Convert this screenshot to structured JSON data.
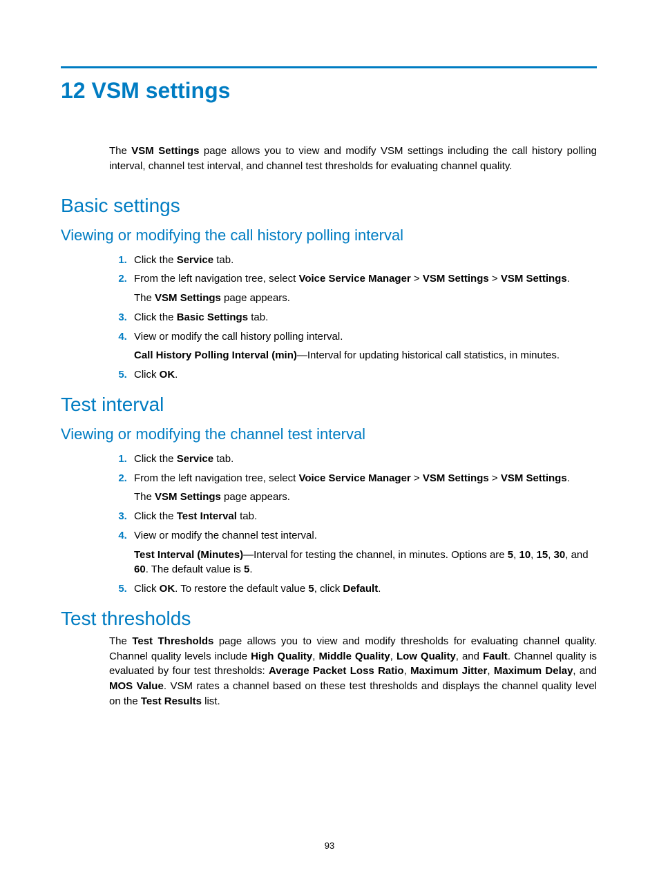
{
  "chapter_title": "12 VSM settings",
  "intro": {
    "pre": "The ",
    "bold": "VSM Settings",
    "post": " page allows you to view and modify VSM settings including the call history polling interval, channel test interval, and channel test thresholds for evaluating channel quality."
  },
  "basic": {
    "heading": "Basic settings",
    "sub": "Viewing or modifying the call history polling interval",
    "steps": {
      "s1": {
        "pre": "Click the ",
        "b1": "Service",
        "post": " tab."
      },
      "s2": {
        "pre": "From the left navigation tree, select ",
        "b1": "Voice Service Manager",
        "gt1": " > ",
        "b2": "VSM Settings",
        "gt2": " > ",
        "b3": "VSM Settings",
        "post1": ".",
        "line2_pre": "The ",
        "line2_b": "VSM Settings",
        "line2_post": " page appears."
      },
      "s3": {
        "pre": "Click the ",
        "b1": "Basic Settings",
        "post": " tab."
      },
      "s4": {
        "line1": "View or modify the call history polling interval.",
        "line2_b": "Call History Polling Interval (min)",
        "line2_post": "—Interval for updating historical call statistics, in minutes."
      },
      "s5": {
        "pre": "Click ",
        "b1": "OK",
        "post": "."
      }
    }
  },
  "testint": {
    "heading": "Test interval",
    "sub": "Viewing or modifying the channel test interval",
    "steps": {
      "s1": {
        "pre": "Click the ",
        "b1": "Service",
        "post": " tab."
      },
      "s2": {
        "pre": "From the left navigation tree, select ",
        "b1": "Voice Service Manager",
        "gt1": " > ",
        "b2": "VSM Settings",
        "gt2": " > ",
        "b3": "VSM Settings",
        "post1": ".",
        "line2_pre": "The ",
        "line2_b": "VSM Settings",
        "line2_post": " page appears."
      },
      "s3": {
        "pre": "Click the ",
        "b1": "Test Interval",
        "post": " tab."
      },
      "s4": {
        "line1": "View or modify the channel test interval.",
        "l2_b1": "Test Interval (Minutes)",
        "l2_t1": "—Interval for testing the channel, in minutes. Options are ",
        "l2_b2": "5",
        "l2_c1": ", ",
        "l2_b3": "10",
        "l2_c2": ", ",
        "l2_b4": "15",
        "l2_c3": ", ",
        "l2_b5": "30",
        "l2_c4": ", and ",
        "l2_b6": "60",
        "l2_t2": ". The default value is ",
        "l2_b7": "5",
        "l2_t3": "."
      },
      "s5": {
        "pre": "Click ",
        "b1": "OK",
        "mid": ". To restore the default value ",
        "b2": "5",
        "mid2": ", click ",
        "b3": "Default",
        "post": "."
      }
    }
  },
  "thresh": {
    "heading": "Test thresholds",
    "p": {
      "t1": "The ",
      "b1": "Test Thresholds",
      "t2": " page allows you to view and modify thresholds for evaluating channel quality. Channel quality levels include ",
      "b2": "High Quality",
      "c1": ", ",
      "b3": "Middle Quality",
      "c2": ", ",
      "b4": "Low Quality",
      "c3": ", and ",
      "b5": "Fault",
      "t3": ". Channel quality is evaluated by four test thresholds: ",
      "b6": "Average Packet Loss Ratio",
      "c4": ", ",
      "b7": "Maximum Jitter",
      "c5": ", ",
      "b8": "Maximum Delay",
      "c6": ", and ",
      "b9": "MOS Value",
      "t4": ". VSM rates a channel based on these test thresholds and displays the channel quality level on the ",
      "b10": "Test Results",
      "t5": " list."
    }
  },
  "page_number": "93"
}
